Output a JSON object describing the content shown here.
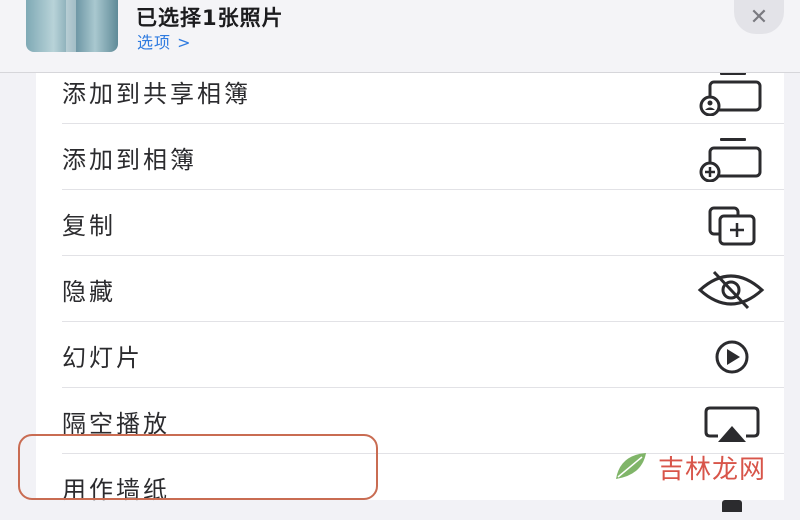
{
  "header": {
    "title": "已选择1张照片",
    "options_label": "选项 >",
    "close_glyph": "✕"
  },
  "menu": {
    "items": [
      {
        "label": "添加到共享相簿",
        "icon": "shared-album-icon"
      },
      {
        "label": "添加到相簿",
        "icon": "add-album-icon"
      },
      {
        "label": "复制",
        "icon": "duplicate-icon"
      },
      {
        "label": "隐藏",
        "icon": "hide-eye-icon"
      },
      {
        "label": "幻灯片",
        "icon": "play-icon"
      },
      {
        "label": "隔空播放",
        "icon": "airplay-icon"
      },
      {
        "label": "用作墙纸",
        "icon": "wallpaper-icon"
      }
    ]
  },
  "watermark": {
    "text": "吉林龙网"
  },
  "colors": {
    "accent": "#2f7be0",
    "highlight": "#c96c52",
    "watermark": "#d8554a"
  }
}
